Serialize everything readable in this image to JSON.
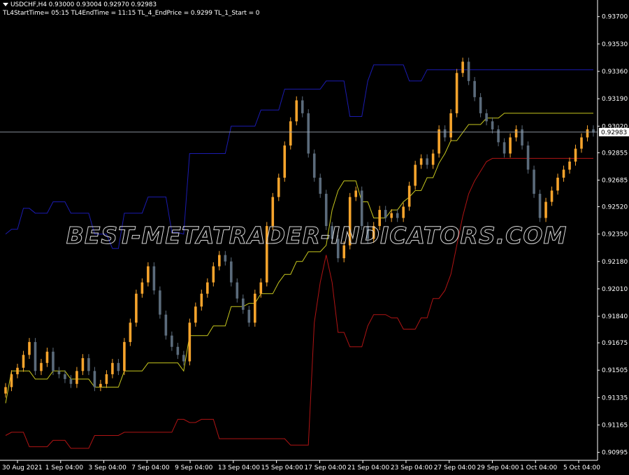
{
  "header": {
    "symbol_line": "USDCHF,H4  0.93000 0.93004 0.92970 0.92983",
    "info_line": "TL4StartTime= 05:15 TL4EndTime = 11:15 TL_4_EndPrice = 0.9299 TL_1_Start = 0"
  },
  "watermark": "BEST-METATRADER-INDICATORS.COM",
  "current_price_label": "0.92983",
  "colors": {
    "background": "#000000",
    "bull_candle": "#f7a42c",
    "bear_candle": "#5b6b7b",
    "upper_band": "#1b1bb0",
    "middle_band": "#c8c81e",
    "lower_band": "#b01414",
    "axis_text": "#ffffff",
    "price_line": "#9aa4b0"
  },
  "chart_data": {
    "type": "line",
    "title": "",
    "symbol": "USDCHF",
    "timeframe": "H4",
    "price_axis_ticks": [
      "0.93700",
      "0.93530",
      "0.93360",
      "0.93190",
      "0.93020",
      "0.92855",
      "0.92685",
      "0.92520",
      "0.92350",
      "0.92180",
      "0.92010",
      "0.91840",
      "0.91675",
      "0.91505",
      "0.91335",
      "0.91165",
      "0.90995"
    ],
    "time_axis_labels": [
      "30 Aug 2021",
      "1 Sep 04:00",
      "3 Sep 04:00",
      "7 Sep 04:00",
      "9 Sep 04:00",
      "13 Sep 04:00",
      "15 Sep 04:00",
      "17 Sep 04:00",
      "21 Sep 04:00",
      "23 Sep 04:00",
      "27 Sep 04:00",
      "29 Sep 04:00",
      "1 Oct 04:00",
      "5 Oct 04:00"
    ],
    "ylim": [
      0.9095,
      0.9379
    ],
    "current_price": 0.92983,
    "series": [
      {
        "name": "upper",
        "values": [
          0.9235,
          0.9238,
          0.9238,
          0.9251,
          0.9251,
          0.9248,
          0.9248,
          0.9248,
          0.9255,
          0.9255,
          0.9255,
          0.9248,
          0.9248,
          0.9248,
          0.9248,
          0.9235,
          0.9235,
          0.9235,
          0.9226,
          0.9226,
          0.9248,
          0.9248,
          0.9248,
          0.9248,
          0.9258,
          0.9258,
          0.9258,
          0.9258,
          0.9236,
          0.9236,
          0.9235,
          0.9285,
          0.9285,
          0.9285,
          0.9285,
          0.9285,
          0.9285,
          0.9285,
          0.9302,
          0.9302,
          0.9302,
          0.9302,
          0.9302,
          0.9312,
          0.9312,
          0.9312,
          0.9312,
          0.9325,
          0.9325,
          0.9325,
          0.9325,
          0.9325,
          0.9325,
          0.9325,
          0.933,
          0.933,
          0.933,
          0.933,
          0.9308,
          0.9308,
          0.9308,
          0.933,
          0.934,
          0.934,
          0.934,
          0.934,
          0.934,
          0.934,
          0.933,
          0.933,
          0.933,
          0.9337,
          0.9337,
          0.9337,
          0.9337,
          0.9337,
          0.9337,
          0.9337,
          0.9337,
          0.9337,
          0.9337,
          0.9337,
          0.9337,
          0.9337,
          0.9337,
          0.9337,
          0.9337,
          0.9337,
          0.9337,
          0.9337,
          0.9337,
          0.9337,
          0.9337,
          0.9337,
          0.9337,
          0.9337,
          0.9337,
          0.9337,
          0.9337,
          0.9337
        ]
      },
      {
        "name": "middle",
        "values": [
          0.913,
          0.915,
          0.915,
          0.915,
          0.915,
          0.9145,
          0.9145,
          0.9145,
          0.915,
          0.915,
          0.915,
          0.9145,
          0.9145,
          0.9145,
          0.9145,
          0.914,
          0.914,
          0.914,
          0.914,
          0.914,
          0.915,
          0.915,
          0.915,
          0.915,
          0.9155,
          0.9155,
          0.9155,
          0.9155,
          0.9155,
          0.9155,
          0.915,
          0.9172,
          0.9172,
          0.9172,
          0.9172,
          0.9178,
          0.9178,
          0.9178,
          0.919,
          0.919,
          0.919,
          0.9192,
          0.9192,
          0.9198,
          0.9198,
          0.9198,
          0.9205,
          0.921,
          0.921,
          0.9218,
          0.9218,
          0.9224,
          0.9224,
          0.9224,
          0.9228,
          0.925,
          0.9262,
          0.9268,
          0.9268,
          0.9268,
          0.9255,
          0.9255,
          0.9245,
          0.9245,
          0.9245,
          0.925,
          0.925,
          0.9255,
          0.9258,
          0.9262,
          0.9262,
          0.927,
          0.927,
          0.9279,
          0.9285,
          0.9293,
          0.9293,
          0.9298,
          0.9303,
          0.9303,
          0.9303,
          0.9307,
          0.9307,
          0.9307,
          0.931,
          0.931,
          0.931,
          0.931,
          0.931,
          0.931,
          0.931,
          0.931,
          0.931,
          0.931,
          0.931,
          0.931,
          0.931,
          0.931,
          0.931,
          0.931
        ]
      },
      {
        "name": "lower",
        "values": [
          0.911,
          0.9112,
          0.9112,
          0.9112,
          0.9103,
          0.9103,
          0.9103,
          0.9103,
          0.9107,
          0.9107,
          0.9107,
          0.9102,
          0.9102,
          0.9102,
          0.9102,
          0.911,
          0.911,
          0.911,
          0.911,
          0.911,
          0.9112,
          0.9112,
          0.9112,
          0.9112,
          0.9112,
          0.9112,
          0.9112,
          0.9112,
          0.9112,
          0.912,
          0.912,
          0.9118,
          0.9118,
          0.912,
          0.912,
          0.912,
          0.9108,
          0.9108,
          0.9108,
          0.9108,
          0.9108,
          0.9108,
          0.9108,
          0.9108,
          0.9108,
          0.9108,
          0.9108,
          0.9108,
          0.9104,
          0.9104,
          0.9104,
          0.9104,
          0.918,
          0.9205,
          0.9222,
          0.9205,
          0.9174,
          0.9174,
          0.9165,
          0.9165,
          0.9165,
          0.9178,
          0.9185,
          0.9185,
          0.9185,
          0.9183,
          0.9183,
          0.9176,
          0.9176,
          0.9176,
          0.9183,
          0.9183,
          0.9195,
          0.9195,
          0.92,
          0.921,
          0.9228,
          0.9246,
          0.926,
          0.9268,
          0.9274,
          0.928,
          0.9282,
          0.9282,
          0.9282,
          0.9282,
          0.9282,
          0.9282,
          0.9282,
          0.9282,
          0.9282,
          0.9282,
          0.9282,
          0.9282,
          0.9282,
          0.9282,
          0.9282,
          0.9282,
          0.9282,
          0.9282
        ]
      },
      {
        "name": "price",
        "values": [
          0.914,
          0.9148,
          0.9152,
          0.916,
          0.9168,
          0.915,
          0.9155,
          0.9162,
          0.915,
          0.9148,
          0.9145,
          0.9142,
          0.915,
          0.9158,
          0.915,
          0.914,
          0.9142,
          0.9148,
          0.9155,
          0.915,
          0.9168,
          0.918,
          0.9198,
          0.9205,
          0.9215,
          0.92,
          0.9185,
          0.9172,
          0.9165,
          0.916,
          0.9156,
          0.918,
          0.919,
          0.9198,
          0.9205,
          0.9215,
          0.9222,
          0.9218,
          0.9205,
          0.9195,
          0.9188,
          0.918,
          0.9198,
          0.9205,
          0.924,
          0.9258,
          0.927,
          0.929,
          0.9305,
          0.9318,
          0.931,
          0.9285,
          0.927,
          0.926,
          0.924,
          0.9232,
          0.922,
          0.9228,
          0.9258,
          0.9262,
          0.924,
          0.9232,
          0.924,
          0.925,
          0.9245,
          0.9248,
          0.9245,
          0.9252,
          0.9265,
          0.9278,
          0.9282,
          0.9278,
          0.9285,
          0.93,
          0.9295,
          0.931,
          0.9335,
          0.9342,
          0.933,
          0.932,
          0.931,
          0.9305,
          0.93,
          0.9292,
          0.9285,
          0.9295,
          0.93,
          0.929,
          0.9275,
          0.926,
          0.9245,
          0.9255,
          0.9262,
          0.927,
          0.9275,
          0.928,
          0.9288,
          0.9295,
          0.93,
          0.9298
        ]
      }
    ]
  }
}
